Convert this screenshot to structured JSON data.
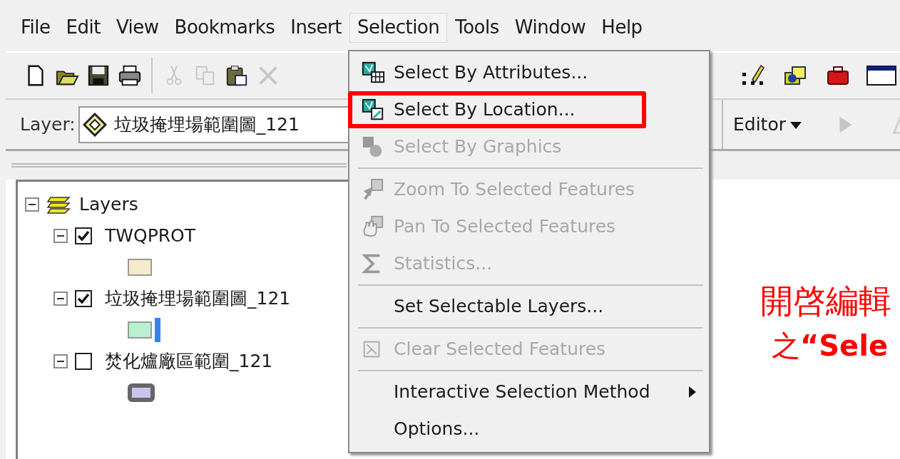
{
  "menu_bar": [
    {
      "label": "File",
      "selected": false
    },
    {
      "label": "Edit",
      "selected": false
    },
    {
      "label": "View",
      "selected": false
    },
    {
      "label": "Bookmarks",
      "selected": false
    },
    {
      "label": "Insert",
      "selected": false
    },
    {
      "label": "Selection",
      "selected": true
    },
    {
      "label": "Tools",
      "selected": false
    },
    {
      "label": "Window",
      "selected": false
    },
    {
      "label": "Help",
      "selected": false
    }
  ],
  "standard_toolbar": [
    {
      "kind": "new",
      "disabled": false
    },
    {
      "kind": "open",
      "disabled": false
    },
    {
      "kind": "save",
      "disabled": false
    },
    {
      "kind": "print",
      "disabled": false
    },
    {
      "kind": "separator"
    },
    {
      "kind": "cut",
      "disabled": true
    },
    {
      "kind": "copy",
      "disabled": true
    },
    {
      "kind": "paste",
      "disabled": false
    },
    {
      "kind": "delete",
      "disabled": true
    }
  ],
  "right_toolbar": [
    {
      "kind": "edit",
      "disabled": false
    },
    {
      "kind": "catalog",
      "disabled": false
    },
    {
      "kind": "toolbox",
      "disabled": false
    },
    {
      "kind": "window",
      "disabled": false
    }
  ],
  "layer_toolbar": {
    "label": "Layer:",
    "value": "垃圾掩埋場範圍圖_121"
  },
  "editor_toolbar": {
    "label": "Editor",
    "tools": [
      {
        "kind": "pointer",
        "disabled": true
      },
      {
        "kind": "sketch",
        "disabled": true
      }
    ]
  },
  "toc": {
    "label": "Layers",
    "expanded": true,
    "children": [
      {
        "label": "TWQPROT",
        "expanded": true,
        "checked": true,
        "color": "#f5ebcb",
        "kind": "fill"
      },
      {
        "label": "垃圾掩埋場範圍圖_121",
        "expanded": true,
        "checked": true,
        "color": "#b9f0cf",
        "kind": "selected-fill"
      },
      {
        "label": "焚化爐廠區範圍_121",
        "expanded": true,
        "checked": false,
        "color": "#c9c3ef",
        "kind": "outline-fill"
      }
    ]
  },
  "selection_menu": [
    {
      "kind": "attributes",
      "label": "Select By Attributes...",
      "disabled": false
    },
    {
      "kind": "location",
      "label": "Select By Location...",
      "disabled": false,
      "annotated": true
    },
    {
      "kind": "graphics",
      "label": "Select By Graphics",
      "disabled": true
    },
    {
      "kind": "separator"
    },
    {
      "kind": "zoom",
      "label": "Zoom To Selected Features",
      "disabled": true
    },
    {
      "kind": "pan",
      "label": "Pan To Selected Features",
      "disabled": true
    },
    {
      "kind": "statistics",
      "label": "Statistics...",
      "disabled": true
    },
    {
      "kind": "separator"
    },
    {
      "kind": "plain",
      "label": "Set Selectable Layers...",
      "disabled": false
    },
    {
      "kind": "separator"
    },
    {
      "kind": "clear",
      "label": "Clear Selected Features",
      "disabled": true
    },
    {
      "kind": "separator"
    },
    {
      "kind": "submenu",
      "label": "Interactive Selection Method",
      "disabled": false
    },
    {
      "kind": "plain",
      "label": "Options...",
      "disabled": false
    }
  ],
  "annotation": {
    "line_1": "開啓編輯",
    "line_2": "之**“Sele**"
  }
}
